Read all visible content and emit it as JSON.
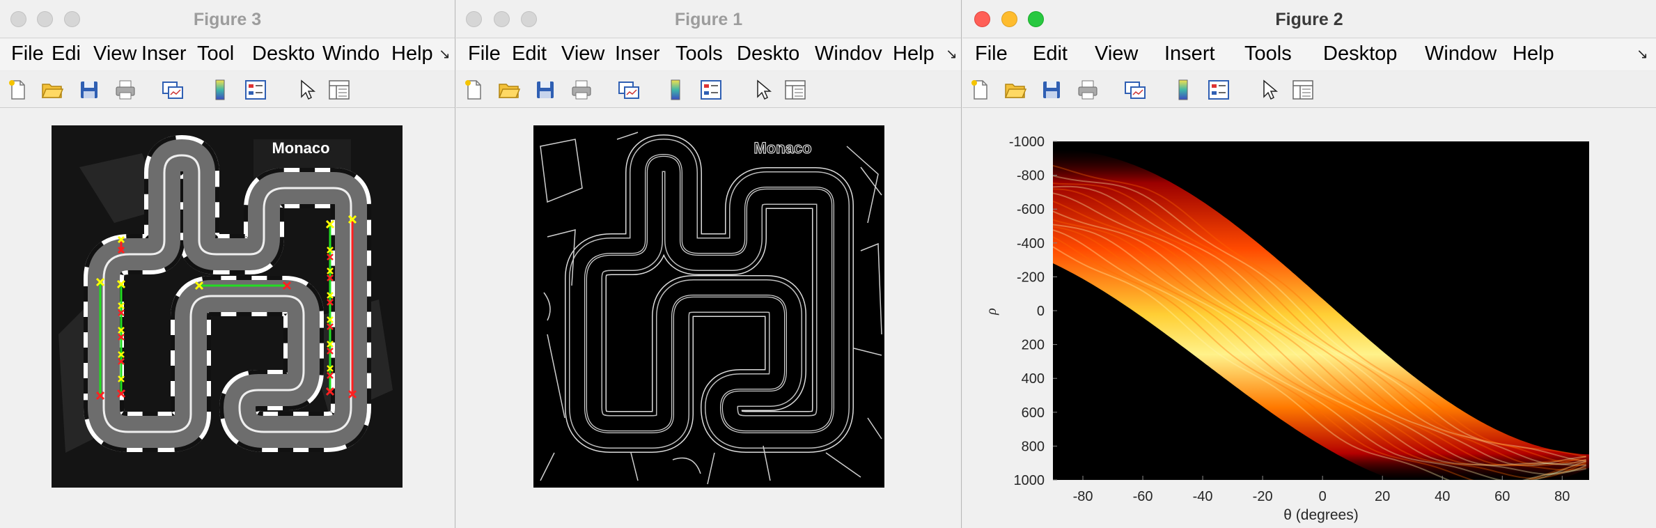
{
  "menu_labels_narrow": [
    "File",
    "Edi",
    "View",
    "Inser",
    "Tool",
    "Deskto",
    "Windo",
    "Help"
  ],
  "menu_labels_mid": [
    "File",
    "Edit",
    "View",
    "Inser",
    "Tools",
    "Deskto",
    "Windov",
    "Help"
  ],
  "menu_labels_full": [
    "File",
    "Edit",
    "View",
    "Insert",
    "Tools",
    "Desktop",
    "Window",
    "Help"
  ],
  "windows": {
    "fig3": {
      "title": "Figure 3",
      "overlay_text": "Monaco"
    },
    "fig1": {
      "title": "Figure 1",
      "overlay_text": "Monaco"
    },
    "fig2": {
      "title": "Figure 2",
      "chart_data": {
        "type": "heatmap",
        "xlabel": "θ (degrees)",
        "ylabel": "ρ",
        "xlim": [
          -90,
          89
        ],
        "ylim": [
          -1000,
          1000
        ],
        "y_reversed": true,
        "xticks": [
          -80,
          -60,
          -40,
          -20,
          0,
          20,
          40,
          60,
          80
        ],
        "yticks": [
          -1000,
          -800,
          -600,
          -400,
          -200,
          0,
          200,
          400,
          600,
          800,
          1000
        ],
        "colormap": "hot"
      }
    }
  },
  "toolbar_icons": [
    "new-figure-icon",
    "open-file-icon",
    "save-icon",
    "print-icon",
    "link-plot-icon",
    "insert-colorbar-icon",
    "insert-legend-icon",
    "edit-plot-icon",
    "property-inspector-icon"
  ],
  "colors": {
    "track_gray": "#6d6d6d",
    "line_green": "#22dd22",
    "line_red": "#ff2020",
    "marker_yellow": "#ffff00"
  }
}
